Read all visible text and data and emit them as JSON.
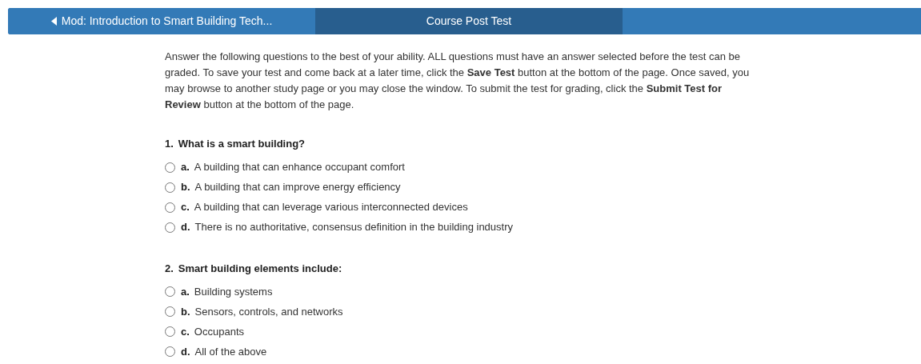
{
  "nav": {
    "tabs": [
      {
        "kind": "back",
        "label": "Mod: Introduction to Smart Building Tech...",
        "selected": false
      },
      {
        "kind": "plain",
        "label": "Course Post Test",
        "selected": true
      }
    ]
  },
  "instructions": "Answer the following questions to the best of your ability. ALL questions must have an answer selected before the test can be graded. To save your test and come back at a later time, click the **Save Test** button at the bottom of the page. Once saved, you may browse to another study page or you may close the window. To submit the test for grading, click the **Submit Test for Review** button at the bottom of the page.",
  "questions": [
    {
      "number": "1.",
      "text": "What is a smart building?",
      "options": [
        {
          "letter": "a.",
          "text": "A building that can enhance occupant comfort",
          "selected": false
        },
        {
          "letter": "b.",
          "text": "A building that can improve energy efficiency",
          "selected": false
        },
        {
          "letter": "c.",
          "text": "A building that can leverage various interconnected devices",
          "selected": false
        },
        {
          "letter": "d.",
          "text": "There is no authoritative, consensus definition in the building industry",
          "selected": false
        }
      ]
    },
    {
      "number": "2.",
      "text": "Smart building elements include:",
      "options": [
        {
          "letter": "a.",
          "text": "Building systems",
          "selected": false
        },
        {
          "letter": "b.",
          "text": "Sensors, controls, and networks",
          "selected": false
        },
        {
          "letter": "c.",
          "text": "Occupants",
          "selected": false
        },
        {
          "letter": "d.",
          "text": "All of the above",
          "selected": false
        }
      ]
    }
  ]
}
